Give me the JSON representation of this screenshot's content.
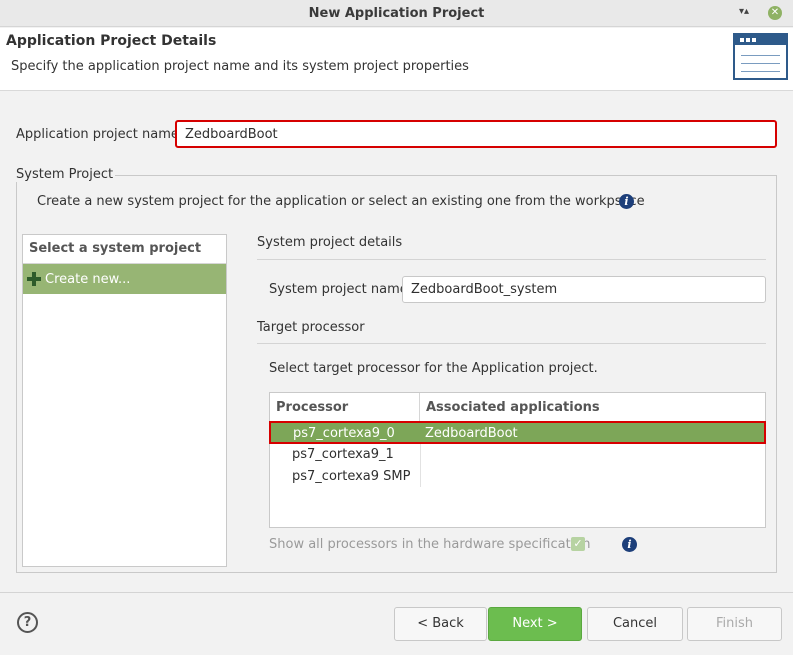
{
  "window": {
    "title": "New Application Project",
    "restore_glyph": "▾▴",
    "close_glyph": "✕"
  },
  "header": {
    "title": "Application Project Details",
    "description": "Specify the application project name and its system project properties",
    "icon": "wizard-window-icon"
  },
  "app_project": {
    "label": "Application project name:",
    "value": "ZedboardBoot"
  },
  "system_project": {
    "group_label": "System Project",
    "description": "Create a new system project for the application or select an existing one from the workpsace",
    "info_glyph": "i",
    "list": {
      "header": "Select a system project",
      "items": [
        {
          "label": "Create new...",
          "icon": "plus-icon"
        }
      ]
    },
    "details": {
      "section_title": "System project details",
      "name_label": "System project name:",
      "name_value": "ZedboardBoot_system"
    },
    "target": {
      "section_title": "Target processor",
      "instruction": "Select target processor for the Application project.",
      "columns": [
        "Processor",
        "Associated applications"
      ],
      "rows": [
        {
          "processor": "ps7_cortexa9_0",
          "apps": "ZedboardBoot",
          "selected": true
        },
        {
          "processor": "ps7_cortexa9_1",
          "apps": ""
        },
        {
          "processor": "ps7_cortexa9 SMP",
          "apps": ""
        }
      ],
      "show_all_label": "Show all processors in the hardware specification",
      "show_all_checked": true,
      "check_glyph": "✓"
    }
  },
  "footer": {
    "help_glyph": "?",
    "back": "< Back",
    "next": "Next >",
    "cancel": "Cancel",
    "finish": "Finish"
  },
  "colors": {
    "accent_green": "#6cbd4f",
    "selection_green": "#7da658",
    "highlight_red": "#d60000",
    "info_blue": "#1d3f7a"
  }
}
